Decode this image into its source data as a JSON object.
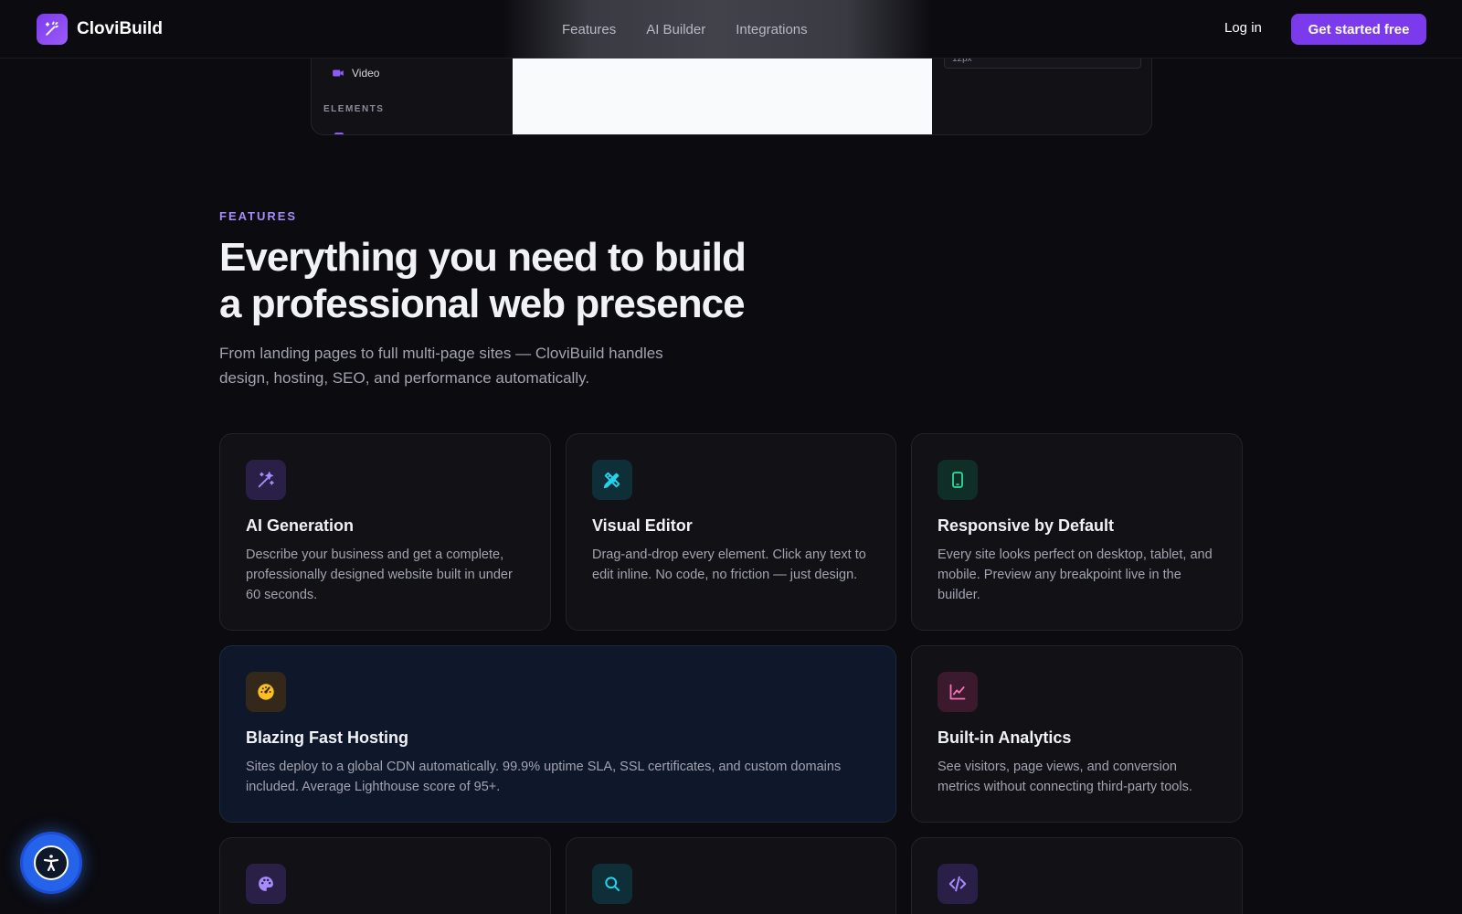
{
  "nav": {
    "brand": "CloviBuild",
    "links": [
      "Features",
      "AI Builder",
      "Integrations"
    ],
    "login": "Log in",
    "cta": "Get started free"
  },
  "preview": {
    "item_label": "Video",
    "section_label": "ELEMENTS",
    "field_value": "12px"
  },
  "features": {
    "eyebrow": "FEATURES",
    "headline_line1": "Everything you need to build",
    "headline_line2": "a professional web presence",
    "subhead": "From landing pages to full multi-page sites — CloviBuild handles design, hosting, SEO, and performance automatically.",
    "cards": [
      {
        "title": "AI Generation",
        "desc": "Describe your business and get a complete, professionally designed website built in under 60 seconds.",
        "icon": "magic-wand-icon",
        "icon_color": "#a78bfa",
        "icon_bg": "#2a1f47"
      },
      {
        "title": "Visual Editor",
        "desc": "Drag-and-drop every element. Click any text to edit inline. No code, no friction — just design.",
        "icon": "pencil-ruler-icon",
        "icon_color": "#22d3ee",
        "icon_bg": "#0f2f38"
      },
      {
        "title": "Responsive by Default",
        "desc": "Every site looks perfect on desktop, tablet, and mobile. Preview any breakpoint live in the builder.",
        "icon": "smartphone-icon",
        "icon_color": "#34d399",
        "icon_bg": "#0f2e25"
      },
      {
        "title": "Blazing Fast Hosting",
        "desc": "Sites deploy to a global CDN automatically. 99.9% uptime SLA, SSL certificates, and custom domains included. Average Lighthouse score of 95+.",
        "icon": "gauge-icon",
        "icon_color": "#fbbf24",
        "icon_bg": "#33281a"
      },
      {
        "title": "Built-in Analytics",
        "desc": "See visitors, page views, and conversion metrics without connecting third-party tools.",
        "icon": "line-chart-icon",
        "icon_color": "#f472b6",
        "icon_bg": "#3a1a2c"
      },
      {
        "title": "",
        "desc": "",
        "icon": "palette-icon",
        "icon_color": "#a78bfa",
        "icon_bg": "#2a1f47"
      },
      {
        "title": "",
        "desc": "",
        "icon": "search-icon",
        "icon_color": "#22d3ee",
        "icon_bg": "#0f2f38"
      },
      {
        "title": "",
        "desc": "",
        "icon": "code-icon",
        "icon_color": "#a78bfa",
        "icon_bg": "#2a1f47"
      }
    ]
  },
  "accessibility": {
    "icon": "accessibility-icon"
  }
}
